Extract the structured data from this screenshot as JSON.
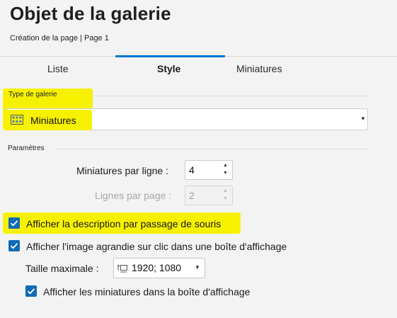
{
  "header": {
    "title": "Objet de la galerie",
    "subtitle": "Création de la page | Page 1"
  },
  "tabs": [
    {
      "label": "Liste",
      "active": false
    },
    {
      "label": "Style",
      "active": true
    },
    {
      "label": "Miniatures",
      "active": false
    }
  ],
  "gallery_type": {
    "label": "Type de galerie",
    "selected": "Miniatures",
    "icon": "thumbnail-grid-icon"
  },
  "parameters": {
    "label": "Paramètres",
    "thumbs_per_row": {
      "label": "Miniatures par ligne :",
      "value": "4"
    },
    "rows_per_page": {
      "label": "Lignes par page :",
      "value": "2",
      "disabled": true
    }
  },
  "options": {
    "hover_description": {
      "label": "Afficher la description par passage de souris",
      "checked": true
    },
    "lightbox_on_click": {
      "label": "Afficher l'image agrandie sur clic dans une boîte d'affichage",
      "checked": true
    },
    "max_size": {
      "label": "Taille maximale :",
      "value": "1920; 1080",
      "icon": "size-icon"
    },
    "lightbox_thumbs": {
      "label": "Afficher les miniatures dans la boîte d'affichage",
      "checked": true
    }
  },
  "colors": {
    "accent": "#0078d4",
    "checkbox": "#0f6bb5",
    "highlight": "#f6f100",
    "background": "#f3f3f3"
  }
}
